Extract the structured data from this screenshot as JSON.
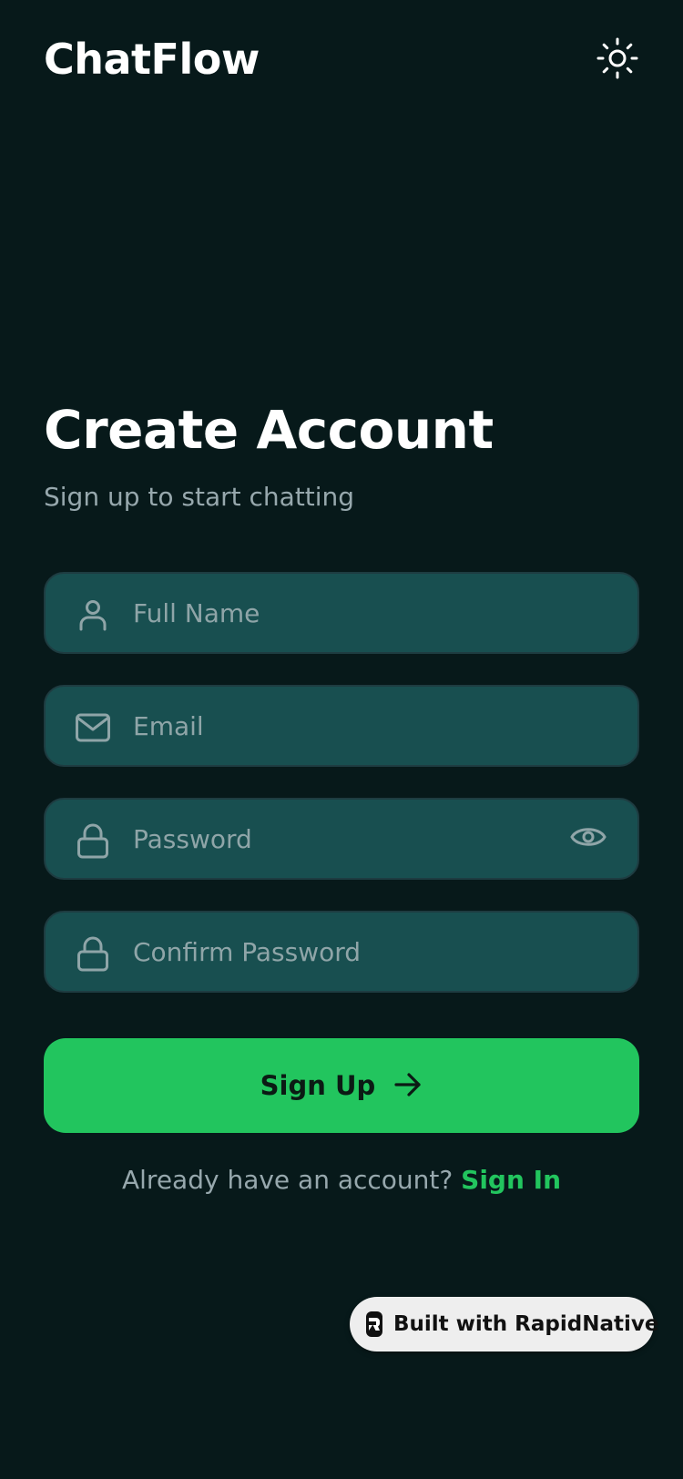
{
  "header": {
    "app_title": "ChatFlow",
    "theme_icon": "sun-icon"
  },
  "intro": {
    "title": "Create Account",
    "subtitle": "Sign up to start chatting"
  },
  "form": {
    "full_name": {
      "placeholder": "Full Name",
      "value": "",
      "icon": "user-icon"
    },
    "email": {
      "placeholder": "Email",
      "value": "",
      "icon": "mail-icon"
    },
    "password": {
      "placeholder": "Password",
      "value": "",
      "icon": "lock-icon",
      "toggle_icon": "eye-icon"
    },
    "confirm_password": {
      "placeholder": "Confirm Password",
      "value": "",
      "icon": "lock-icon"
    },
    "submit_label": "Sign Up",
    "submit_icon": "arrow-right-icon"
  },
  "signin": {
    "prompt": "Already have an account? ",
    "link_label": "Sign In"
  },
  "badge": {
    "label": "Built with RapidNative"
  },
  "colors": {
    "background": "#07191a",
    "field_background": "#184f50",
    "accent": "#22c55e",
    "muted_text": "#97a8ad"
  }
}
